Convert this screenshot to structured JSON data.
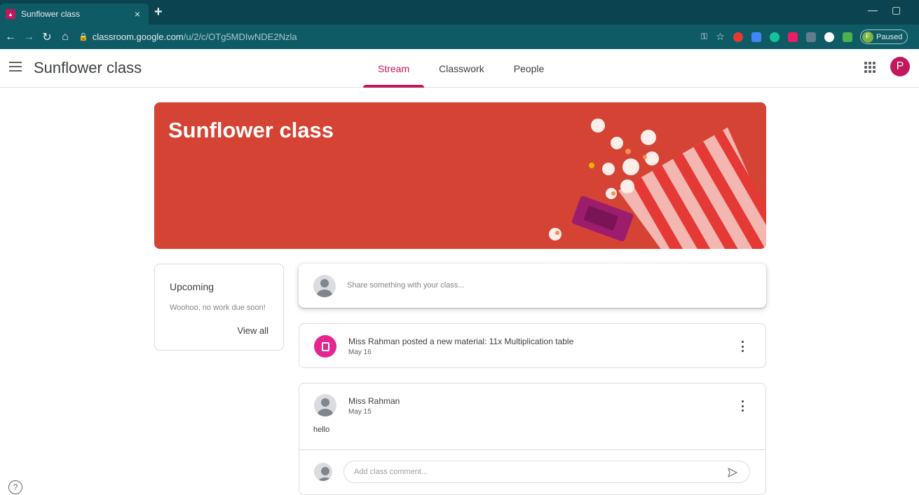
{
  "browser": {
    "tab_title": "Sunflower class",
    "tab_close": "×",
    "new_tab": "+",
    "url_host": "classroom.google.com",
    "url_path": "/u/2/c/OTg5MDIwNDE2Nzla",
    "profile_initial": "F",
    "profile_status": "Paused",
    "minimize": "—",
    "restore": "▢"
  },
  "header": {
    "class_name": "Sunflower class",
    "tabs": [
      {
        "label": "Stream",
        "active": true
      },
      {
        "label": "Classwork",
        "active": false
      },
      {
        "label": "People",
        "active": false
      }
    ],
    "avatar_initial": "P"
  },
  "banner": {
    "title": "Sunflower class",
    "color": "#d44333"
  },
  "upcoming": {
    "heading": "Upcoming",
    "message": "Woohoo, no work due soon!",
    "view_all": "View all"
  },
  "share": {
    "placeholder": "Share something with your class..."
  },
  "posts": [
    {
      "title": "Miss Rahman posted a new material: 11x Multiplication table",
      "date": "May 16"
    },
    {
      "author": "Miss Rahman",
      "date": "May 15",
      "text": "hello",
      "comment_placeholder": "Add class comment..."
    }
  ],
  "colors": {
    "accent": "#c2185b",
    "material": "#e52592",
    "chrome_dark": "#0b4450",
    "chrome": "#0e5b66"
  },
  "help": "?"
}
